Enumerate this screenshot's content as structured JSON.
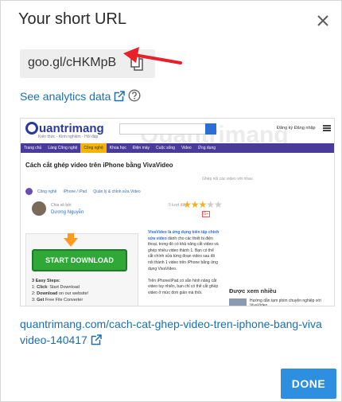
{
  "dialog": {
    "title": "Your short URL",
    "short_url": "goo.gl/cHKMpB",
    "analytics_link": "See analytics data",
    "long_url": "quantrimang.com/cach-cat-ghep-video-tren-iphone-bang-vivavideo-140417",
    "done_label": "DONE"
  },
  "preview": {
    "site_logo": "uantrimang",
    "site_tagline": "Kiến thức - Kinh nghiệm - Hỏi đáp",
    "watermark": "Quantrimang",
    "login": "Đăng ký   Đăng nhập",
    "nav_items": [
      "Trang chủ",
      "Làng Công nghệ",
      "Công nghệ",
      "Khoa học",
      "Điện máy",
      "Cuộc sống",
      "Video",
      "Ứng dụng"
    ],
    "nav_active_index": 2,
    "article_title": "Cách cắt ghép video trên iPhone bằng VivaVideo",
    "article_subtitle": "Ghép nối các video với nhau",
    "breadcrumbs": [
      "Công nghệ",
      "iPhone / iPad",
      "Quản lý & chỉnh sửa Video"
    ],
    "author_by": "Chia sẻ bởi",
    "author_name": "Dương Nguyễn",
    "rating_label": "5 lượt đánh",
    "rating": 3,
    "rating_max": 5,
    "ad_button": "START DOWNLOAD",
    "ad_steps_title": "3 Easy Steps:",
    "ad_step1_bold": "Click",
    "ad_step1": ": Start Download",
    "ad_step2_bold": "Download",
    "ad_step2": " on our website!",
    "ad_step3_bold": "Get",
    "ad_step3": " Free File Converter",
    "body_text_1_hl": "VivaVideo là ứng dụng biên tập chỉnh sửa video",
    "body_text_1": " dành cho các thiết bị điện thoại, trong đó có khả năng cắt video và ghép nhiều video thành 1. Bạn có thể cắt chính sửa từng đoạn video sau đó nối thành 1 video trên iPhone bằng ứng dụng VivaVideo.",
    "body_text_2": "Trên iPhone/iPad có sẵn hình năng cắt video tuy nhiên, bạn chỉ có thể cắt ghép video ở mức đơn giản mà thôi.",
    "sidebar_heading": "Được xem nhiều",
    "sidebar_item": "Hướng dẫn tạm phim chuyện nghiệp với VivaVideo"
  },
  "colors": {
    "link": "#1a6fb0",
    "done_button": "#2e8fe0",
    "arrow": "#e8202a"
  }
}
